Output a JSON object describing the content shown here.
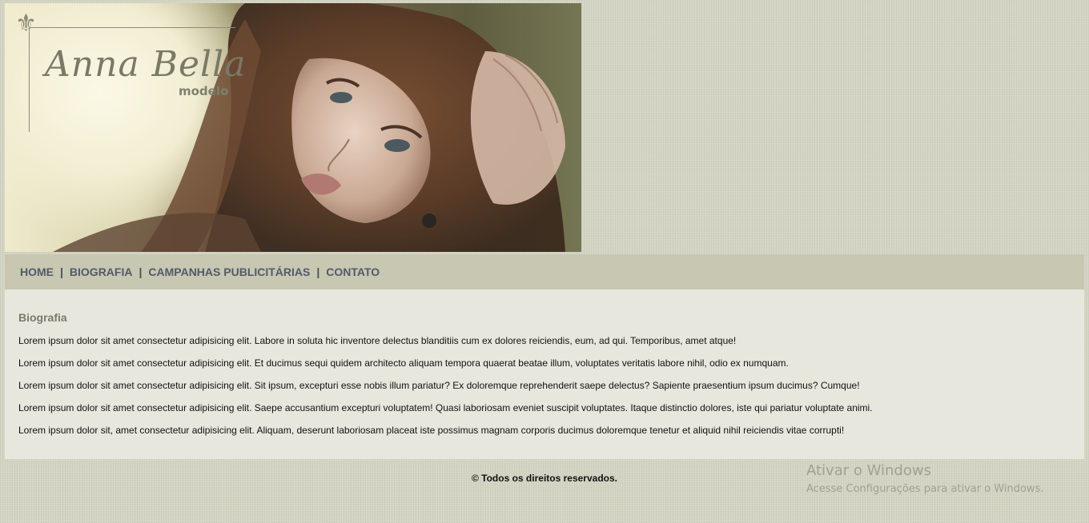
{
  "header": {
    "logo_icon": "fleur-de-lis-icon",
    "logo_name": "Anna Bella",
    "logo_subtitle": "modelo"
  },
  "nav": {
    "items": [
      {
        "label": "HOME"
      },
      {
        "label": "BIOGRAFIA"
      },
      {
        "label": "CAMPANHAS PUBLICITÁRIAS"
      },
      {
        "label": "CONTATO"
      }
    ],
    "separator": "|"
  },
  "main": {
    "title": "Biografia",
    "paragraphs": [
      "Lorem ipsum dolor sit amet consectetur adipisicing elit. Labore in soluta hic inventore delectus blanditiis cum ex dolores reiciendis, eum, ad qui. Temporibus, amet atque!",
      "Lorem ipsum dolor sit amet consectetur adipisicing elit. Et ducimus sequi quidem architecto aliquam tempora quaerat beatae illum, voluptates veritatis labore nihil, odio ex numquam.",
      "Lorem ipsum dolor sit amet consectetur adipisicing elit. Sit ipsum, excepturi esse nobis illum pariatur? Ex doloremque reprehenderit saepe delectus? Sapiente praesentium ipsum ducimus? Cumque!",
      "Lorem ipsum dolor sit amet consectetur adipisicing elit. Saepe accusantium excepturi voluptatem! Quasi laboriosam eveniet suscipit voluptates. Itaque distinctio dolores, iste qui pariatur voluptate animi.",
      "Lorem ipsum dolor sit, amet consectetur adipisicing elit. Aliquam, deserunt laboriosam placeat iste possimus magnam corporis ducimus doloremque tenetur et aliquid nihil reiciendis vitae corrupti!"
    ]
  },
  "footer": {
    "text": "© Todos os direitos reservados."
  },
  "watermark": {
    "title": "Ativar o Windows",
    "subtitle": "Acesse Configurações para ativar o Windows."
  },
  "colors": {
    "page_background": "#d4d4c3",
    "nav_background": "#c7c7b2",
    "content_background": "#e7e7de",
    "nav_text": "#515a68",
    "heading_text": "#7b7b6c"
  }
}
